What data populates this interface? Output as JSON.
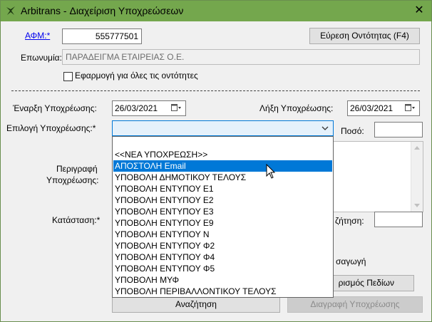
{
  "window": {
    "title": "Arbitrans - Διαχείριση Υποχρεώσεων",
    "close_glyph": "✕"
  },
  "afm": {
    "label": "ΑΦΜ:*",
    "value": "555777501"
  },
  "find_entity_button": "Εύρεση Οντότητας (F4)",
  "name": {
    "label": "Επωνυμία:",
    "value": "ΠΑΡΑΔΕΙΓΜΑ ΕΤΑΙΡΕΙΑΣ Ο.Ε."
  },
  "apply_all": {
    "label": "Εφαρμογή για όλες τις οντότητες",
    "checked": false
  },
  "start_date": {
    "label": "Έναρξη Υποχρέωσης:",
    "value": "26/03/2021"
  },
  "end_date": {
    "label": "Λήξη Υποχρέωσης:",
    "value": "26/03/2021"
  },
  "obligation": {
    "label": "Επιλογή Υποχρέωσης:*",
    "value": ""
  },
  "amount": {
    "label": "Ποσό:",
    "value": ""
  },
  "description": {
    "label_line1": "Περιγραφή",
    "label_line2": "Υποχρέωσης:"
  },
  "status": {
    "label": "Κατάσταση:*"
  },
  "search_field": {
    "label_fragment": "ζήτηση:",
    "value": ""
  },
  "import_fragment": "σαγωγή",
  "fields_button_fragment": "ρισμός Πεδίων",
  "search_button": "Αναζήτηση",
  "delete_button": "Διαγραφή Υποχρέωσης",
  "dropdown": {
    "selected_index": 1,
    "items": [
      "<<ΝΕΑ ΥΠΟΧΡΕΩΣΗ>>",
      "ΑΠΟΣΤΟΛΗ Email",
      "ΥΠΟΒΟΛΗ ΔΗΜΟΤΙΚΟΥ ΤΕΛΟΥΣ",
      "ΥΠΟΒΟΛΗ ΕΝΤΥΠΟΥ Ε1",
      "ΥΠΟΒΟΛΗ ΕΝΤΥΠΟΥ Ε2",
      "ΥΠΟΒΟΛΗ ΕΝΤΥΠΟΥ Ε3",
      "ΥΠΟΒΟΛΗ ΕΝΤΥΠΟΥ Ε9",
      "ΥΠΟΒΟΛΗ ΕΝΤΥΠΟΥ Ν",
      "ΥΠΟΒΟΛΗ ΕΝΤΥΠΟΥ Φ2",
      "ΥΠΟΒΟΛΗ ΕΝΤΥΠΟΥ Φ4",
      "ΥΠΟΒΟΛΗ ΕΝΤΥΠΟΥ Φ5",
      "ΥΠΟΒΟΛΗ ΜΥΦ",
      "ΥΠΟΒΟΛΗ ΠΕΡΙΒΑΛΛΟΝΤΙΚΟΥ ΤΕΛΟΥΣ"
    ]
  },
  "colors": {
    "titlebar": "#74a74d",
    "selection": "#0078d7",
    "link": "#0000ee"
  }
}
